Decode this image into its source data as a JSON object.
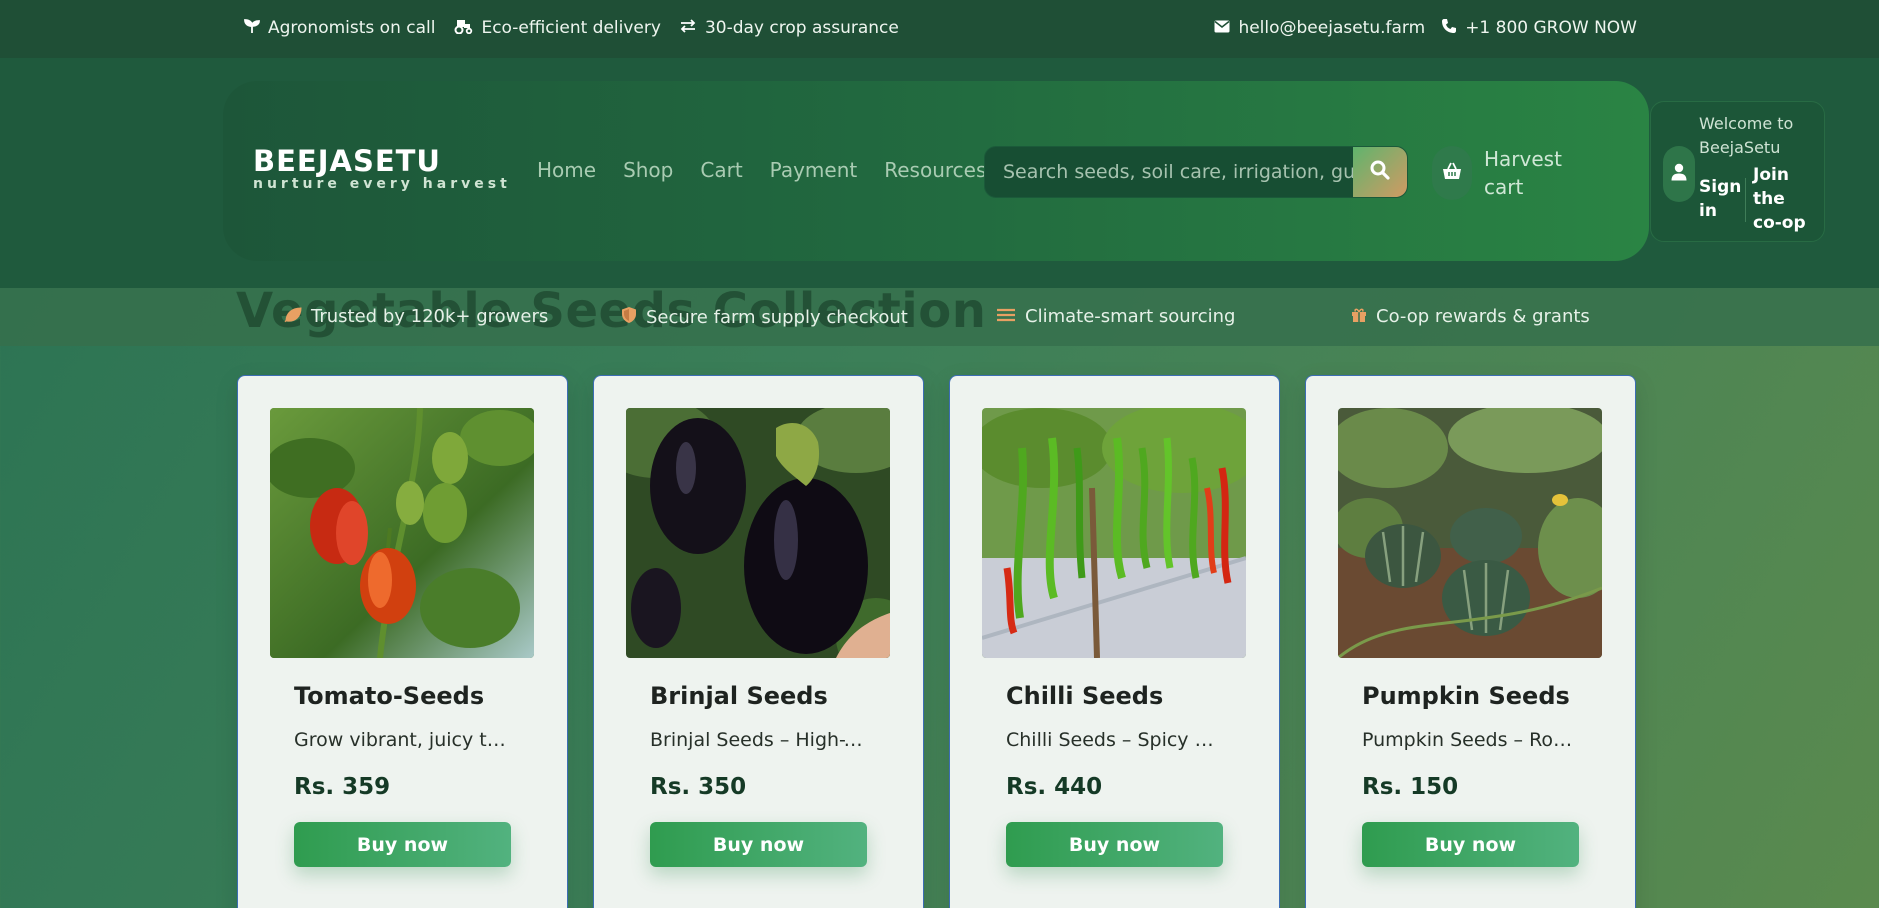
{
  "topbar": {
    "left": [
      {
        "icon": "seedling-icon",
        "label": "Agronomists on call"
      },
      {
        "icon": "tractor-icon",
        "label": "Eco-efficient delivery"
      },
      {
        "icon": "exchange-icon",
        "label": "30-day crop assurance"
      }
    ],
    "right": [
      {
        "icon": "envelope-icon",
        "label": "hello@beejasetu.farm"
      },
      {
        "icon": "phone-icon",
        "label": "+1 800 GROW NOW"
      }
    ]
  },
  "brand": {
    "name": "BEEJASETU",
    "tagline": "nurture every harvest"
  },
  "nav": [
    "Home",
    "Shop",
    "Cart",
    "Payment",
    "Resources"
  ],
  "search": {
    "placeholder": "Search seeds, soil care, irrigation, guides",
    "button_icon": "search-icon"
  },
  "cart": {
    "label": "Harvest cart",
    "icon": "basket-icon"
  },
  "account": {
    "welcome": "Welcome to BeejaSetu",
    "signin": "Sign in",
    "join": "Join the co-op",
    "icon": "user-icon"
  },
  "page_title": "Vegetable Seeds Collection",
  "trust": [
    {
      "icon": "leaf-icon",
      "label": "Trusted by 120k+ growers"
    },
    {
      "icon": "shield-icon",
      "label": "Secure farm supply checkout"
    },
    {
      "icon": "climate-icon",
      "label": "Climate-smart sourcing"
    },
    {
      "icon": "gift-icon",
      "label": "Co-op rewards & grants"
    }
  ],
  "products": [
    {
      "name": "Tomato-Seeds",
      "desc": "Grow vibrant, juicy to...",
      "price": "Rs. 359",
      "cta": "Buy now",
      "image": "red and green bell peppers on plant"
    },
    {
      "name": "Brinjal Seeds",
      "desc": "Brinjal Seeds – High-Y...",
      "price": "Rs. 350",
      "cta": "Buy now",
      "image": "two dark purple eggplants"
    },
    {
      "name": "Chilli Seeds",
      "desc": "Chilli Seeds – Spicy & ...",
      "price": "Rs. 440",
      "cta": "Buy now",
      "image": "green and red chillies on plant"
    },
    {
      "name": "Pumpkin Seeds",
      "desc": "Pumpkin Seeds – Rob...",
      "price": "Rs. 150",
      "cta": "Buy now",
      "image": "green pumpkins in a field"
    }
  ],
  "colors": {
    "accent": "#2f9c4f",
    "topbar": "#1f4f36",
    "header": "#21683f",
    "trust_icon": "#e8a063",
    "card_border": "#3c6db4"
  }
}
